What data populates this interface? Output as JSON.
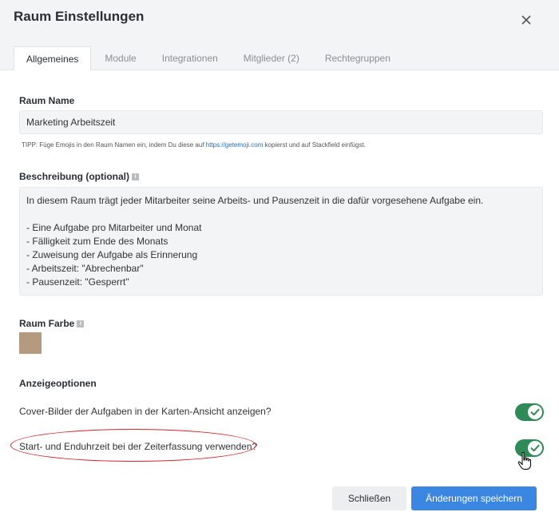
{
  "dialog": {
    "title": "Raum Einstellungen"
  },
  "tabs": [
    {
      "label": "Allgemeines"
    },
    {
      "label": "Module"
    },
    {
      "label": "Integrationen"
    },
    {
      "label": "Mitglieder (2)"
    },
    {
      "label": "Rechtegruppen"
    }
  ],
  "room_name": {
    "label": "Raum Name",
    "value": "Marketing Arbeitszeit",
    "tip_prefix": "TIPP: Füge Emojis in den Raum Namen ein, indem Du diese auf ",
    "tip_link": "https://getemoji.com",
    "tip_suffix": " kopierst und auf Stackfield einfügst."
  },
  "description": {
    "label": "Beschreibung (optional)",
    "lines": [
      "In diesem Raum trägt jeder Mitarbeiter seine Arbeits- und Pausenzeit in die dafür vorgesehene Aufgabe ein.",
      "",
      "- Eine Aufgabe pro Mitarbeiter und Monat",
      "- Fälligkeit zum Ende des Monats",
      "- Zuweisung der Aufgabe als Erinnerung",
      "- Arbeitszeit: \"Abrechenbar\"",
      "- Pausenzeit: \"Gesperrt\""
    ]
  },
  "room_color": {
    "label": "Raum Farbe",
    "color": "#b49a7e"
  },
  "display_options": {
    "label": "Anzeigeoptionen",
    "options": [
      {
        "text": "Cover-Bilder der Aufgaben in der Karten-Ansicht anzeigen?",
        "enabled": true
      },
      {
        "text": "Start- und Enduhrzeit bei der Zeiterfassung verwenden?",
        "enabled": true
      }
    ]
  },
  "buttons": {
    "close": "Schließen",
    "save": "Änderungen speichern"
  },
  "colors": {
    "accent": "#3b86e0",
    "toggle_on": "#2e8a57",
    "highlight": "#d2232a"
  }
}
